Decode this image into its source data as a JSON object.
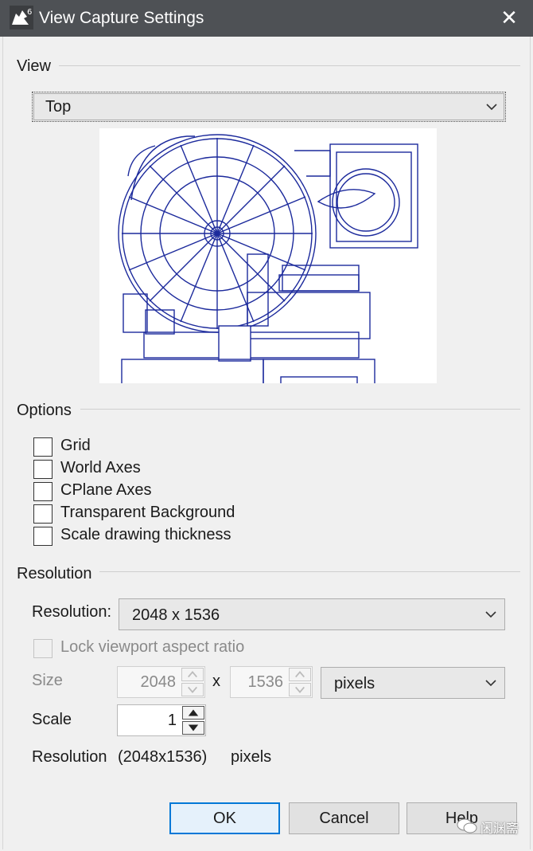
{
  "window": {
    "title": "View Capture Settings",
    "app_icon_badge": "6",
    "close_glyph": "✕"
  },
  "view_section": {
    "label": "View",
    "selected_view": "Top"
  },
  "options_section": {
    "label": "Options",
    "checkboxes": [
      {
        "label": "Grid",
        "checked": false
      },
      {
        "label": "World Axes",
        "checked": false
      },
      {
        "label": "CPlane Axes",
        "checked": false
      },
      {
        "label": "Transparent Background",
        "checked": false
      },
      {
        "label": "Scale drawing thickness",
        "checked": false
      }
    ]
  },
  "resolution_section": {
    "label": "Resolution",
    "resolution_label": "Resolution:",
    "resolution_value": "2048 x 1536",
    "lock_aspect_label": "Lock viewport aspect ratio",
    "size_label": "Size",
    "width_value": "2048",
    "times_glyph": "x",
    "height_value": "1536",
    "units_value": "pixels",
    "scale_label": "Scale",
    "scale_value": "1",
    "summary_label": "Resolution",
    "summary_value": "(2048x1536)",
    "summary_units": "pixels"
  },
  "buttons": {
    "ok": "OK",
    "cancel": "Cancel",
    "help": "Help"
  },
  "watermark": "闲渊斋",
  "colors": {
    "titlebar": "#4e5155",
    "preview_stroke": "#1c2a9c",
    "default_button_border": "#0078d7"
  }
}
